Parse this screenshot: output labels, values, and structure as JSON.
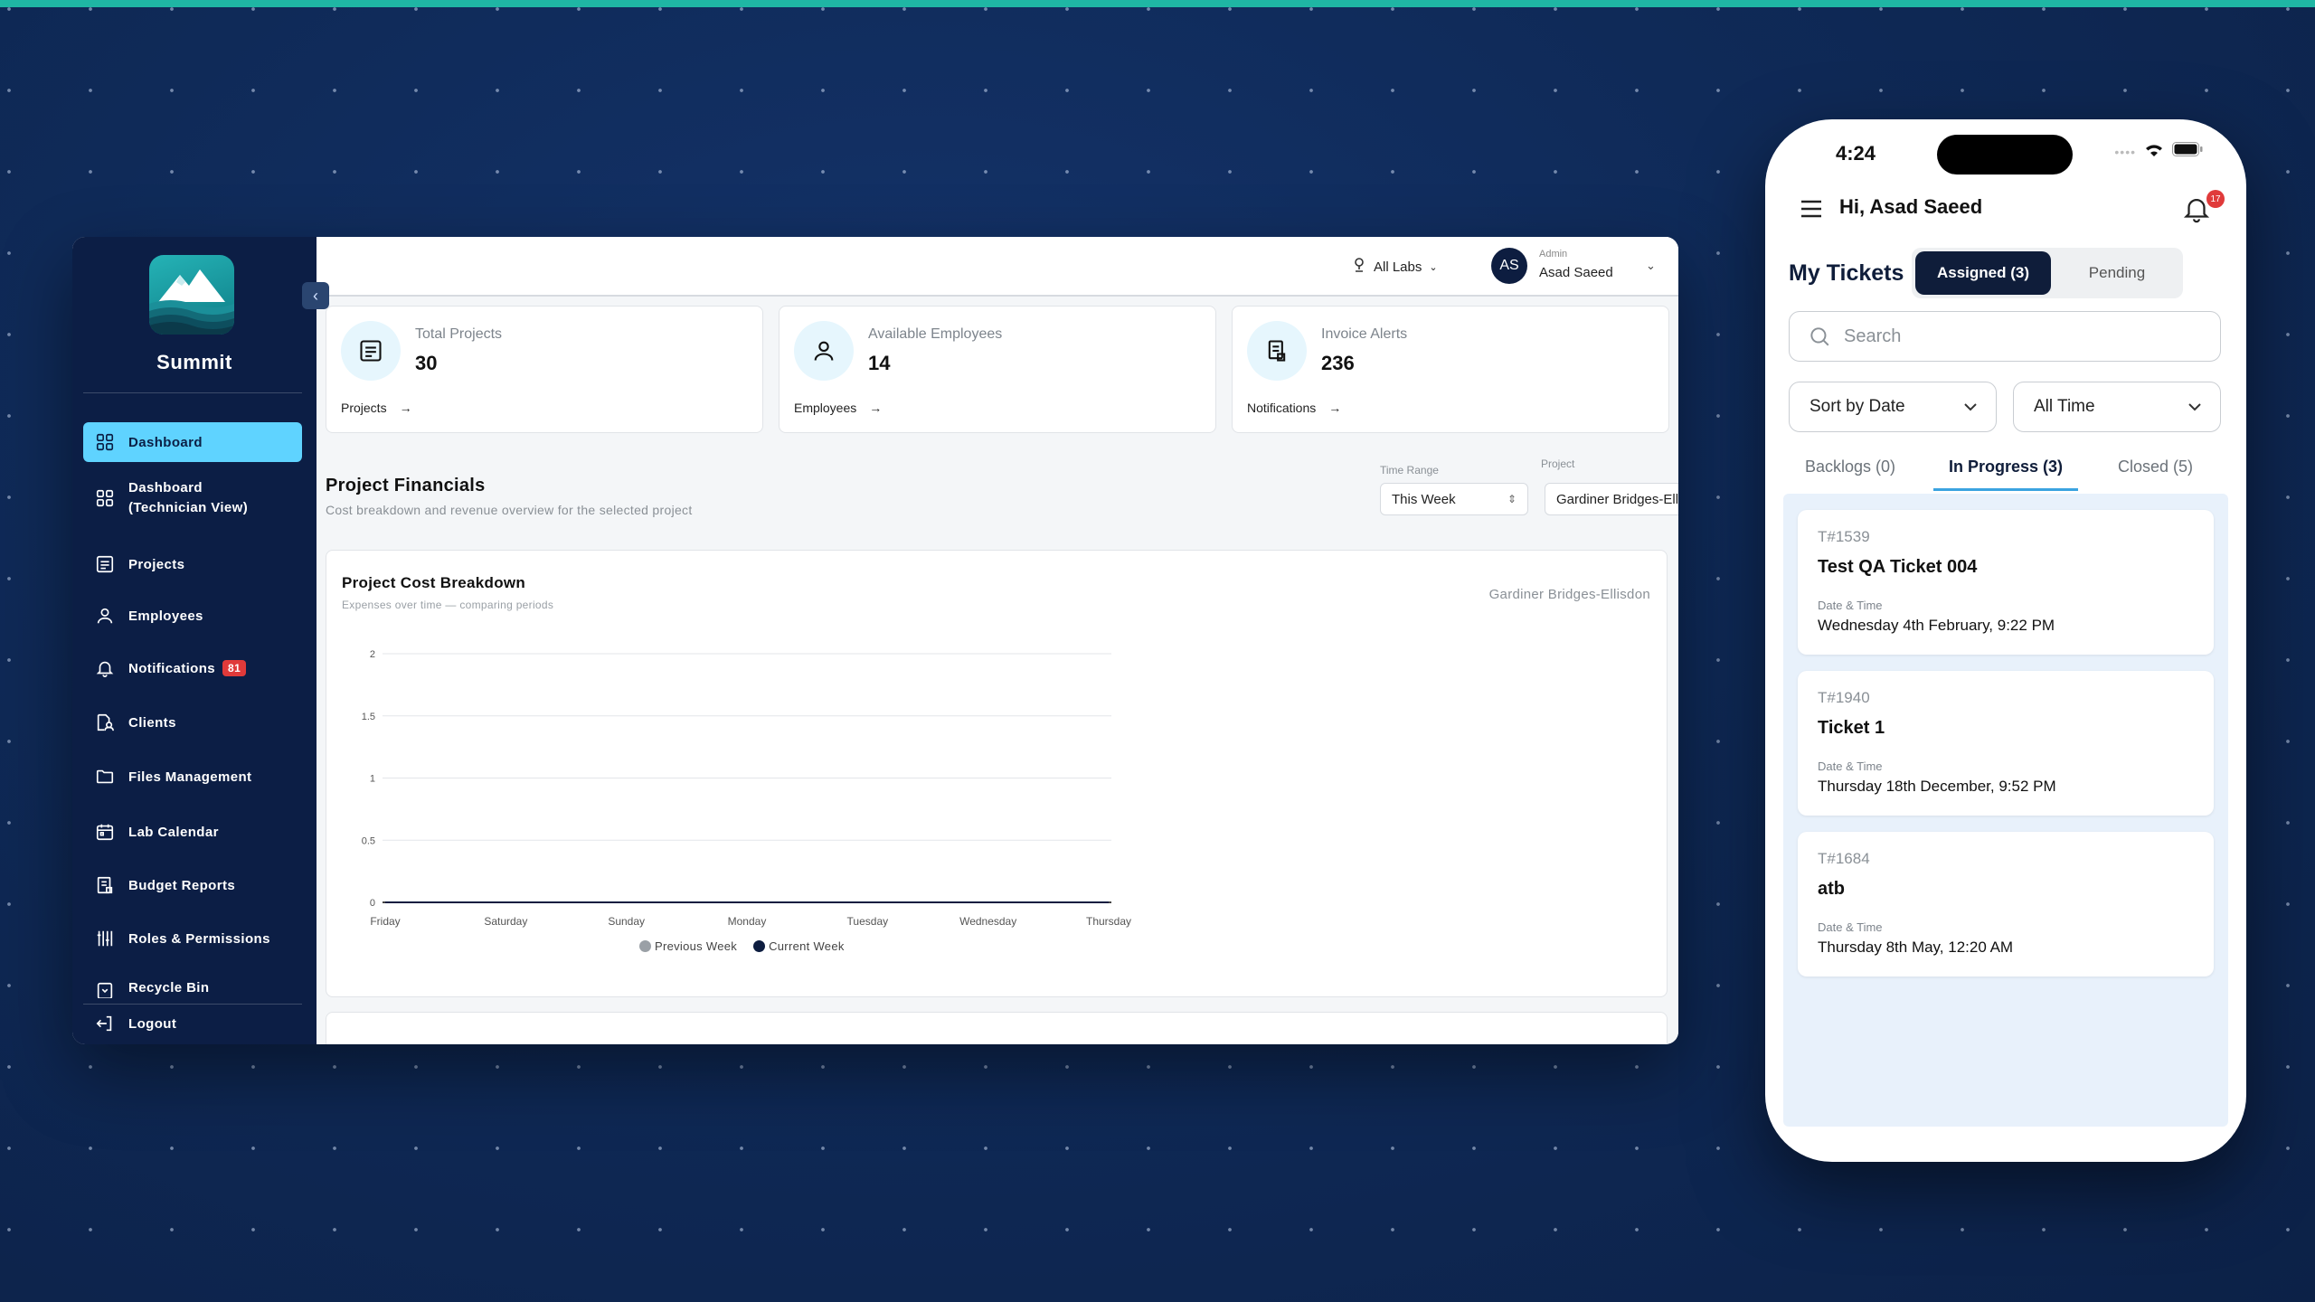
{
  "desktop": {
    "brand": "Summit",
    "nav": [
      {
        "label": "Dashboard",
        "icon": "grid-icon",
        "active": true
      },
      {
        "label": "Dashboard\n(Technician View)",
        "icon": "grid-icon"
      },
      {
        "label": "Projects",
        "icon": "document-icon"
      },
      {
        "label": "Employees",
        "icon": "person-icon"
      },
      {
        "label": "Notifications",
        "icon": "bell-icon",
        "badge": "81"
      },
      {
        "label": "Clients",
        "icon": "clients-icon"
      },
      {
        "label": "Files Management",
        "icon": "folder-icon"
      },
      {
        "label": "Lab Calendar",
        "icon": "calendar-icon"
      },
      {
        "label": "Budget Reports",
        "icon": "report-icon"
      },
      {
        "label": "Roles & Permissions",
        "icon": "permissions-icon"
      },
      {
        "label": "Recycle Bin",
        "icon": "trash-icon"
      }
    ],
    "logout": "Logout",
    "topbar": {
      "labs": "All Labs",
      "avatar_initials": "AS",
      "user_role": "Admin",
      "user_name": "Asad Saeed"
    },
    "stats": [
      {
        "label": "Total Projects",
        "value": "30",
        "link": "Projects",
        "icon": "document-icon"
      },
      {
        "label": "Available Employees",
        "value": "14",
        "link": "Employees",
        "icon": "person-icon"
      },
      {
        "label": "Invoice Alerts",
        "value": "236",
        "link": "Notifications",
        "icon": "invoice-icon"
      }
    ],
    "financials": {
      "title": "Project Financials",
      "subtitle": "Cost breakdown and revenue overview for the selected project",
      "time_range_label": "Time Range",
      "time_range_value": "This Week",
      "project_label": "Project",
      "project_value": "Gardiner Bridges-Elli"
    },
    "chart": {
      "title": "Project Cost Breakdown",
      "subtitle": "Expenses over time — comparing periods",
      "project": "Gardiner Bridges-Ellisdon"
    }
  },
  "chart_data": {
    "type": "line",
    "categories": [
      "Friday",
      "Saturday",
      "Sunday",
      "Monday",
      "Tuesday",
      "Wednesday",
      "Thursday"
    ],
    "series": [
      {
        "name": "Previous Week",
        "values": [
          0,
          0,
          0,
          0,
          0,
          0,
          0
        ],
        "color": "#9aa0a6"
      },
      {
        "name": "Current Week",
        "values": [
          0,
          0,
          0,
          0,
          0,
          0,
          0
        ],
        "color": "#0d1d40"
      }
    ],
    "yticks": [
      "0",
      "0.5",
      "1",
      "1.5",
      "2"
    ],
    "ylim": [
      0,
      2
    ],
    "grid": true,
    "legend": "bottom"
  },
  "phone": {
    "time": "4:24",
    "greeting": "Hi, Asad Saeed",
    "bell_badge": "17",
    "heading": "My Tickets",
    "seg_active": "Assigned (3)",
    "seg_other": "Pending",
    "search_placeholder": "Search",
    "sort": "Sort by Date",
    "range": "All Time",
    "tabs": [
      "Backlogs (0)",
      "In Progress (3)",
      "Closed (5)"
    ],
    "date_label": "Date & Time",
    "tickets": [
      {
        "id": "T#1539",
        "title": "Test QA Ticket 004",
        "date": "Wednesday 4th February, 9:22 PM"
      },
      {
        "id": "T#1940",
        "title": "Ticket 1",
        "date": "Thursday 18th December, 9:52 PM"
      },
      {
        "id": "T#1684",
        "title": "atb",
        "date": "Thursday 8th May, 12:20 AM"
      }
    ]
  }
}
